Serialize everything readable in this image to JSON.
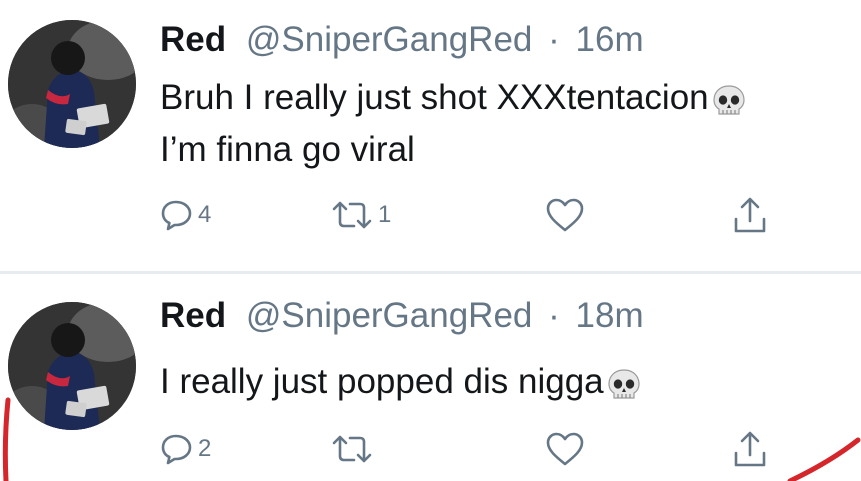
{
  "tweets": [
    {
      "display_name": "Red",
      "handle": "@SniperGangRed",
      "separator": "·",
      "time": "16m",
      "lines": [
        "Bruh I really just shot XXXtentacion",
        "I’m finna go viral"
      ],
      "reply_count": "4",
      "retweet_count": "1",
      "like_count": "",
      "avatar_icon": "profile-photo"
    },
    {
      "display_name": "Red",
      "handle": "@SniperGangRed",
      "separator": "·",
      "time": "18m",
      "lines": [
        "I really just popped dis nigga"
      ],
      "reply_count": "2",
      "retweet_count": "",
      "like_count": "",
      "avatar_icon": "profile-photo"
    }
  ],
  "icons": {
    "reply": "speech-bubble-icon",
    "retweet": "retweet-arrows-icon",
    "like": "heart-icon",
    "share": "share-upload-icon",
    "emoji": "skull-emoji"
  },
  "colors": {
    "text": "#14171a",
    "muted": "#657786",
    "divider": "#e6ecf0",
    "annotation": "#d4262b"
  }
}
